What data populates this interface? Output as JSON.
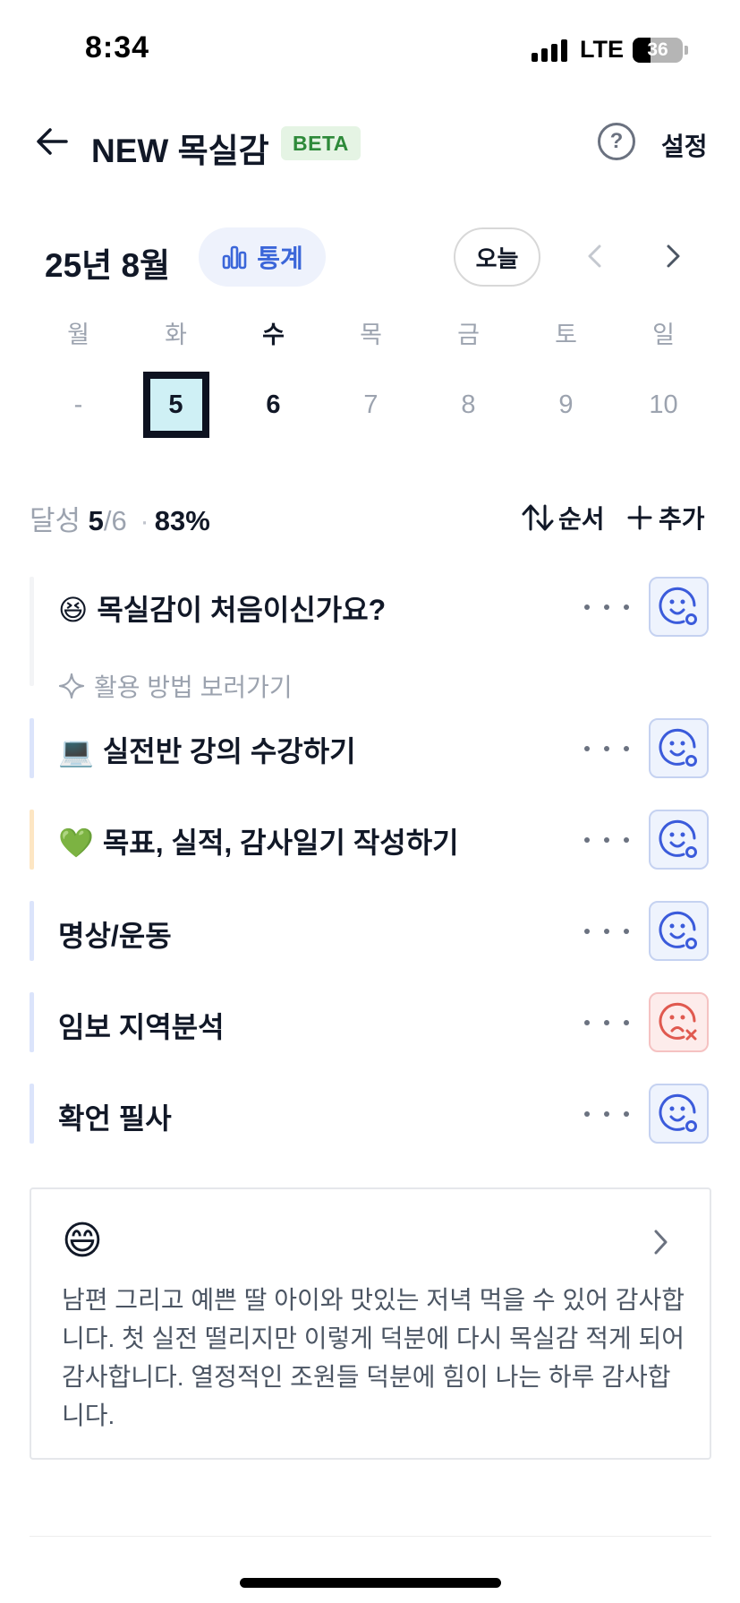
{
  "status_bar": {
    "time": "8:34",
    "network": "LTE",
    "battery": "36",
    "battery_level": 0.36
  },
  "header": {
    "title": "NEW 목실감",
    "badge": "BETA",
    "help_icon": "help-circle-icon",
    "help_label": "?",
    "settings_label": "설정"
  },
  "calendar": {
    "month_label": "25년 8월",
    "stats_label": "통계",
    "today_label": "오늘",
    "weekdays": [
      "월",
      "화",
      "수",
      "목",
      "금",
      "토",
      "일"
    ],
    "dates": [
      "-",
      "5",
      "6",
      "7",
      "8",
      "9",
      "10"
    ],
    "selected_index": 1
  },
  "summary": {
    "label": "달성",
    "done": "5",
    "total": "/6",
    "separator": "·",
    "percent": "83%",
    "order_label": "순서",
    "add_label": "추가"
  },
  "tasks": [
    {
      "emoji": "😆",
      "title": "목실감이 처음이신가요?",
      "status": "happy",
      "bar_color": "#f3f4f6",
      "link_label": "활용 방법 보러가기"
    },
    {
      "emoji": "💻",
      "title": "실전반 강의 수강하기",
      "status": "happy",
      "bar_color": "#dbe4fb"
    },
    {
      "emoji": "💚",
      "title": "목표, 실적, 감사일기 작성하기",
      "status": "happy",
      "bar_color": "#fde6c3"
    },
    {
      "emoji": "",
      "title": "명상/운동",
      "status": "happy",
      "bar_color": "#dbe4fb"
    },
    {
      "emoji": "",
      "title": "임보 지역분석",
      "status": "sad",
      "bar_color": "#dbe4fb"
    },
    {
      "emoji": "",
      "title": "확언 필사",
      "status": "happy",
      "bar_color": "#dbe4fb"
    }
  ],
  "colors": {
    "accent_blue": "#3b66d9",
    "happy_face": "#3b5bdb",
    "sad_face": "#e0594f",
    "beta_green": "#2e8a3a"
  },
  "journal": {
    "emoji": "😄",
    "text": "남편 그리고 예쁜 딸 아이와 맛있는 저녁 먹을 수 있어 감사합니다. 첫 실전 떨리지만 이렇게 덕분에 다시 목실감 적게 되어 감사합니다. 열정적인 조원들 덕분에 힘이 나는 하루 감사합니다."
  }
}
